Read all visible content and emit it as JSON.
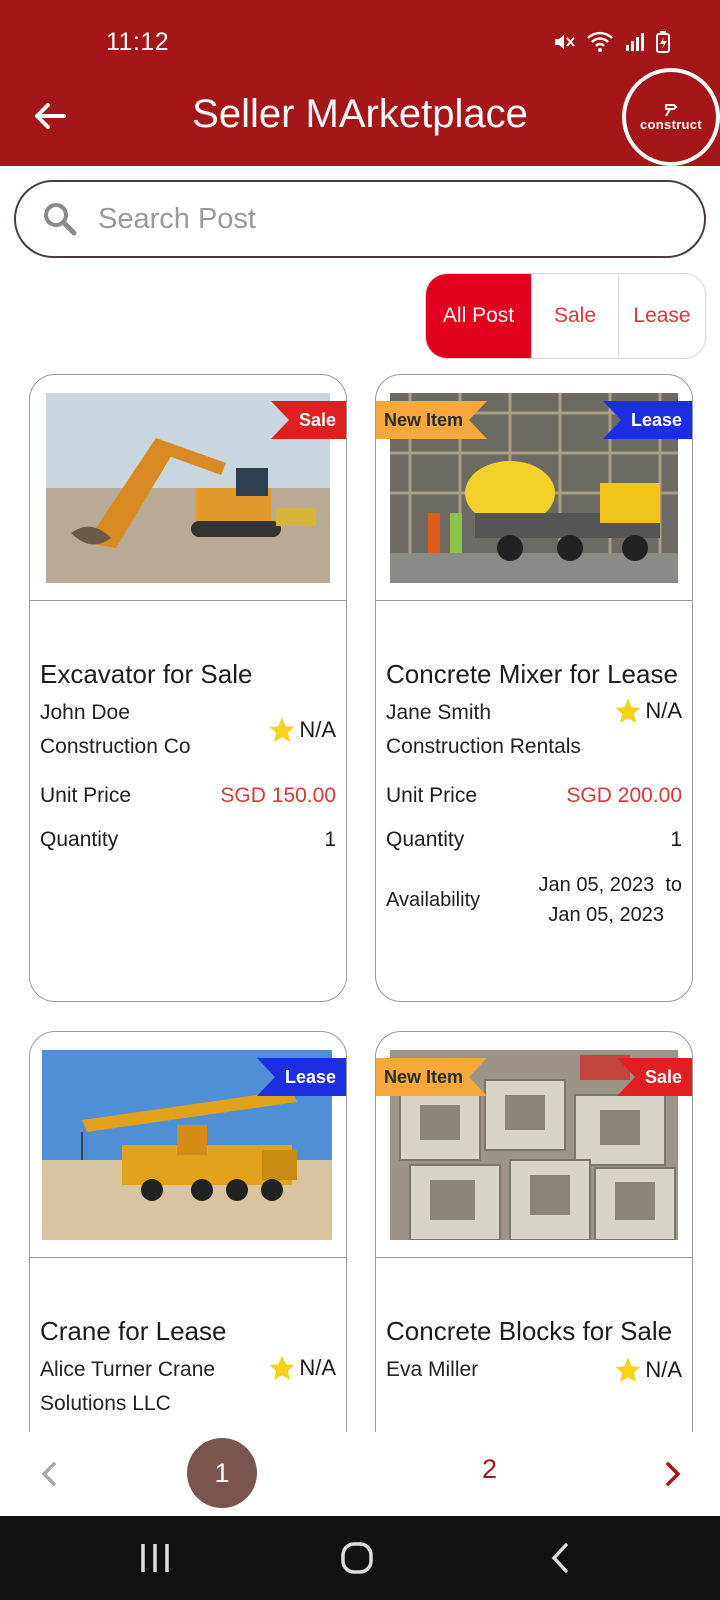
{
  "status_bar": {
    "time": "11:12"
  },
  "header": {
    "title": "Seller MArketplace",
    "logo_text": "construct"
  },
  "search": {
    "placeholder": "Search Post"
  },
  "filters": [
    {
      "label": "All Post",
      "selected": true
    },
    {
      "label": "Sale",
      "selected": false
    },
    {
      "label": "Lease",
      "selected": false
    }
  ],
  "listings": [
    {
      "title": "Excavator for Sale",
      "seller": "John Doe Construction Co",
      "rating": "N/A",
      "badges": [
        "Sale"
      ],
      "unit_price_label": "Unit Price",
      "unit_price": "SGD 150.00",
      "quantity_label": "Quantity",
      "quantity": "1"
    },
    {
      "title": "Concrete Mixer for Lease",
      "seller": "Jane Smith Construction Rentals",
      "rating": "N/A",
      "badges": [
        "New Item",
        "Lease"
      ],
      "unit_price_label": "Unit Price",
      "unit_price": "SGD 200.00",
      "quantity_label": "Quantity",
      "quantity": "1",
      "availability_label": "Availability",
      "availability_from": "Jan 05, 2023  to",
      "availability_to": "Jan 05, 2023"
    },
    {
      "title": "Crane for Lease",
      "seller": "Alice Turner Crane Solutions LLC",
      "rating": "N/A",
      "badges": [
        "Lease"
      ]
    },
    {
      "title": "Concrete Blocks for Sale",
      "seller": "Eva Miller",
      "rating": "N/A",
      "badges": [
        "New Item",
        "Sale"
      ]
    }
  ],
  "pagination": {
    "current": "1",
    "next_page": "2"
  },
  "colors": {
    "primary": "#a51616",
    "accent": "#e2001f",
    "price": "#d93838",
    "sale_badge": "#e02020",
    "lease_badge": "#1b2fe0",
    "new_badge": "#f6a93a"
  }
}
